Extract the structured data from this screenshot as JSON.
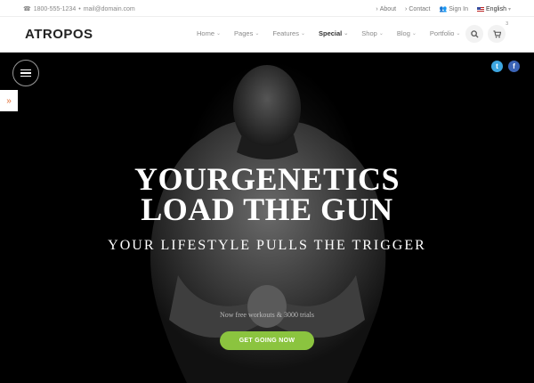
{
  "topbar": {
    "phone": "1800-555-1234",
    "separator": "•",
    "email": "mail@domain.com",
    "about": "About",
    "contact": "Contact",
    "signin": "Sign In",
    "language": "English"
  },
  "header": {
    "logo": "ATROPOS",
    "nav": [
      "Home",
      "Pages",
      "Features",
      "Special",
      "Shop",
      "Blog",
      "Portfolio"
    ],
    "cart_count": "3"
  },
  "hero": {
    "title_line1": "YOURGENETICS",
    "title_line2": "LOAD THE GUN",
    "subtitle": "YOUR LIFESTYLE PULLS THE TRIGGER",
    "note": "Now free workouts & 3000 trials",
    "cta": "GET GOING NOW"
  },
  "social": {
    "twitter": "t",
    "facebook": "f"
  },
  "colors": {
    "accent": "#8bc43f",
    "twitter": "#3da6e0",
    "facebook": "#3b64b6",
    "sidetab_arrow": "#e06a2e"
  }
}
